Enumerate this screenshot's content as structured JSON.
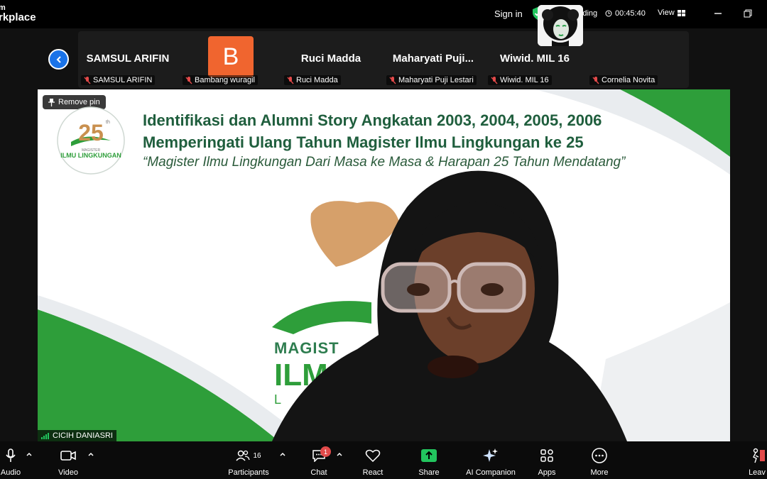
{
  "titlebar": {
    "brand_line1": "m",
    "brand_line2": "rkplace",
    "sign_in": "Sign in",
    "recording": "Recording",
    "timer": "00:45:40",
    "view": "View"
  },
  "strip": {
    "participants": [
      {
        "big": "SAMSUL ARIFIN",
        "small": "SAMSUL ARIFIN"
      },
      {
        "big": "B",
        "small": "Bambang wuragil"
      },
      {
        "big": "Ruci Madda",
        "small": "Ruci Madda"
      },
      {
        "big": "Maharyati  Puji...",
        "small": "Maharyati Puji Lestari"
      },
      {
        "big": "Wiwid. MIL 16",
        "small": "Wiwid. MIL 16"
      },
      {
        "big": "",
        "small": "Cornelia Novita"
      }
    ]
  },
  "main": {
    "pin_label": "Remove pin",
    "slide_line1": "Identifikasi dan Alumni Story Angkatan 2003, 2004, 2005, 2006",
    "slide_line2": "Memperingati Ulang Tahun Magister Ilmu Lingkungan ke 25",
    "slide_subtitle": "“Magister Ilmu Lingkungan Dari Masa ke Masa & Harapan 25 Tahun Mendatang”",
    "logo_number": "25",
    "logo_th": "th",
    "logo_small": "MAGISTER",
    "logo_text": "ILMU LINGKUNGAN",
    "watermark_1": "MAGIST",
    "watermark_2": "ILM",
    "watermark_3": "L",
    "speaker_name": "CICIH DANIASRI"
  },
  "toolbar": {
    "audio": "Audio",
    "video": "Video",
    "participants": "Participants",
    "participants_count": "16",
    "chat": "Chat",
    "chat_badge": "1",
    "react": "React",
    "share": "Share",
    "ai_companion": "AI Companion",
    "apps": "Apps",
    "more": "More",
    "leave": "Leav"
  },
  "colors": {
    "accent_blue": "#1a73e8",
    "recording_red": "#e24a4a",
    "share_green": "#22c55e",
    "slide_green": "#2e9e3a",
    "avatar_orange": "#f0652f"
  }
}
